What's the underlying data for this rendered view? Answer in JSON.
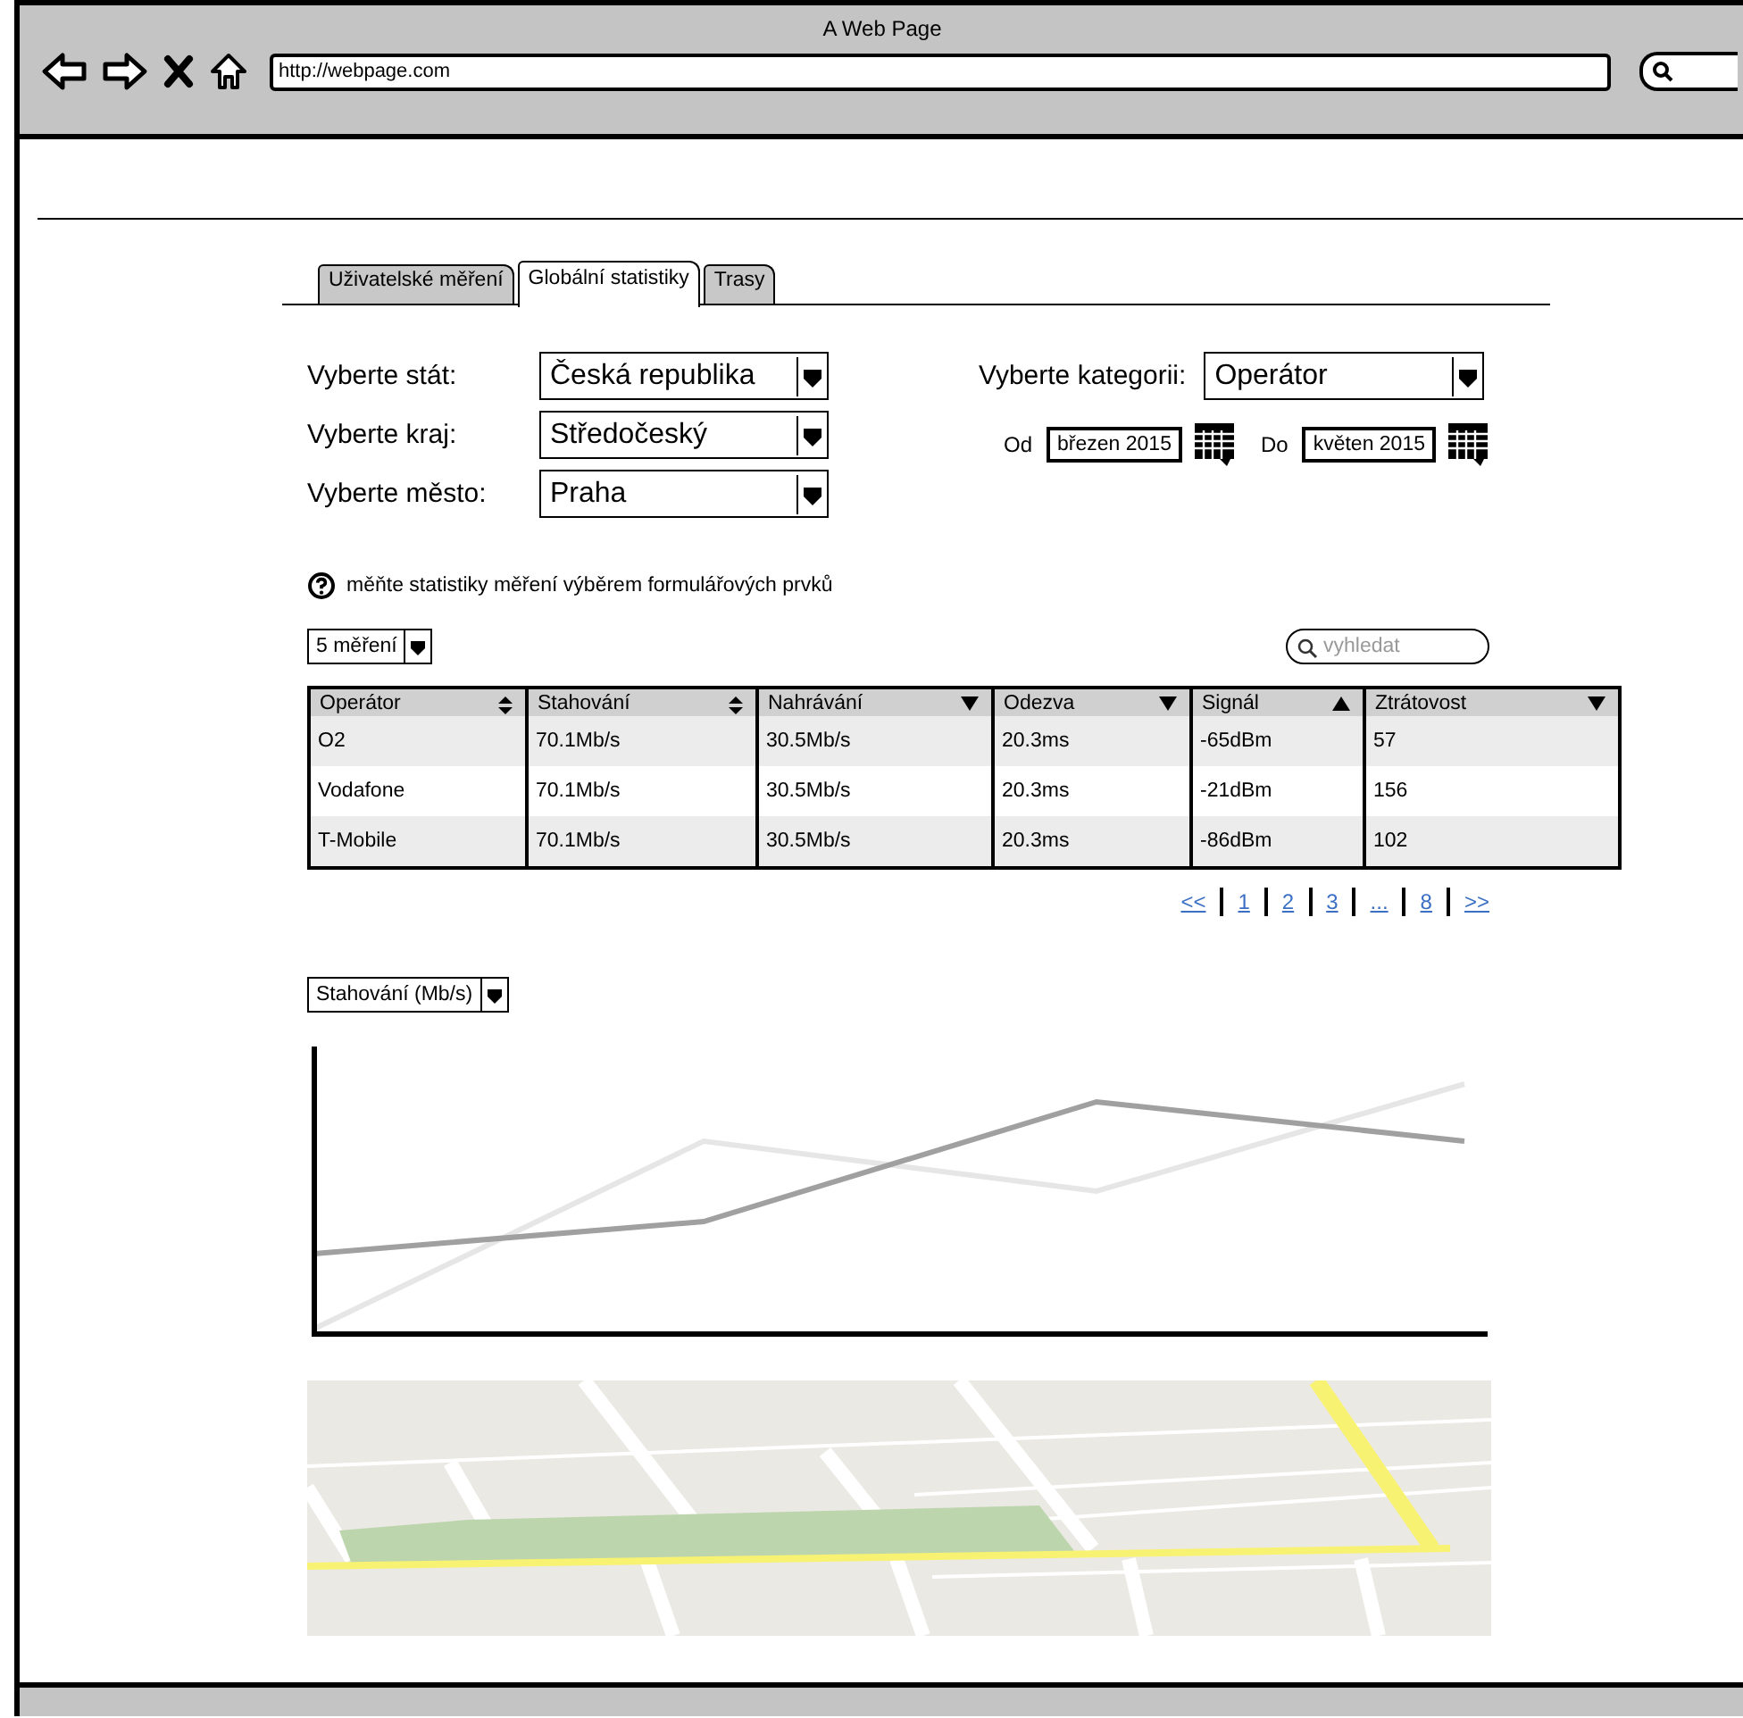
{
  "browser": {
    "title": "A Web Page",
    "url": "http://webpage.com"
  },
  "tabs": [
    {
      "label": "Uživatelské měření",
      "selected": false
    },
    {
      "label": "Globální statistiky",
      "selected": true
    },
    {
      "label": "Trasy",
      "selected": false
    }
  ],
  "filters": [
    {
      "label": "Vyberte stát:",
      "value": "Česká republika"
    },
    {
      "label": "Vyberte kraj:",
      "value": "Středočeský"
    },
    {
      "label": "Vyberte město:",
      "value": "Praha"
    }
  ],
  "category": {
    "label": "Vyberte kategorii:",
    "value": "Operátor"
  },
  "date_range": [
    {
      "label": "Od",
      "value": "březen 2015"
    },
    {
      "label": "Do",
      "value": "květen 2015"
    }
  ],
  "hint": "měňte statistiky měření výběrem formulářových prvků",
  "page_size": "5 měření",
  "search": {
    "placeholder": "vyhledat"
  },
  "table": {
    "columns": [
      {
        "label": "Operátor",
        "kind": "sortable"
      },
      {
        "label": "Stahování",
        "kind": "sortable"
      },
      {
        "label": "Nahrávání",
        "kind": "descending"
      },
      {
        "label": "Odezva",
        "kind": "descending"
      },
      {
        "label": "Signál",
        "kind": "ascending"
      },
      {
        "label": "Ztrátovost",
        "kind": "descending"
      }
    ],
    "rows": [
      [
        "O2",
        "70.1Mb/s",
        "30.5Mb/s",
        "20.3ms",
        "-65dBm",
        "57"
      ],
      [
        "Vodafone",
        "70.1Mb/s",
        "30.5Mb/s",
        "20.3ms",
        "-21dBm",
        "156"
      ],
      [
        "T-Mobile",
        "70.1Mb/s",
        "30.5Mb/s",
        "20.3ms",
        "-86dBm",
        "102"
      ]
    ]
  },
  "pagination": [
    "<<",
    "1",
    "2",
    "3",
    "...",
    "8",
    ">>"
  ],
  "chart_selector": "Stahování (Mb/s)"
}
